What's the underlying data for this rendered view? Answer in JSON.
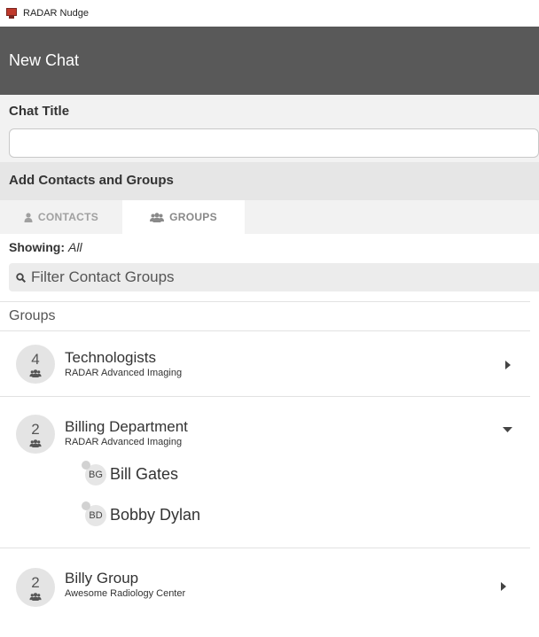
{
  "window": {
    "title": "RADAR Nudge"
  },
  "header": {
    "title": "New Chat"
  },
  "chat_title": {
    "label": "Chat Title",
    "value": "",
    "placeholder": ""
  },
  "add_section": {
    "label": "Add Contacts and Groups"
  },
  "tabs": [
    {
      "label": "CONTACTS",
      "icon": "user-icon",
      "active": false
    },
    {
      "label": "GROUPS",
      "icon": "users-icon",
      "active": true
    }
  ],
  "showing": {
    "label": "Showing:",
    "value": "All"
  },
  "filter": {
    "placeholder": "Filter Contact Groups",
    "icon": "search-icon"
  },
  "groups_header": "Groups",
  "groups": [
    {
      "count": "4",
      "name": "Technologists",
      "org": "RADAR Advanced Imaging",
      "expanded": false,
      "members": []
    },
    {
      "count": "2",
      "name": "Billing Department",
      "org": "RADAR Advanced Imaging",
      "expanded": true,
      "members": [
        {
          "initials": "BG",
          "name": "Bill Gates"
        },
        {
          "initials": "BD",
          "name": "Bobby Dylan"
        }
      ]
    },
    {
      "count": "2",
      "name": "Billy Group",
      "org": "Awesome Radiology Center",
      "expanded": false,
      "members": []
    }
  ],
  "colors": {
    "header_bg": "#595959",
    "panel_bg": "#f2f2f2",
    "section_bg": "#e6e6e6",
    "app_icon": "#c0392b"
  }
}
